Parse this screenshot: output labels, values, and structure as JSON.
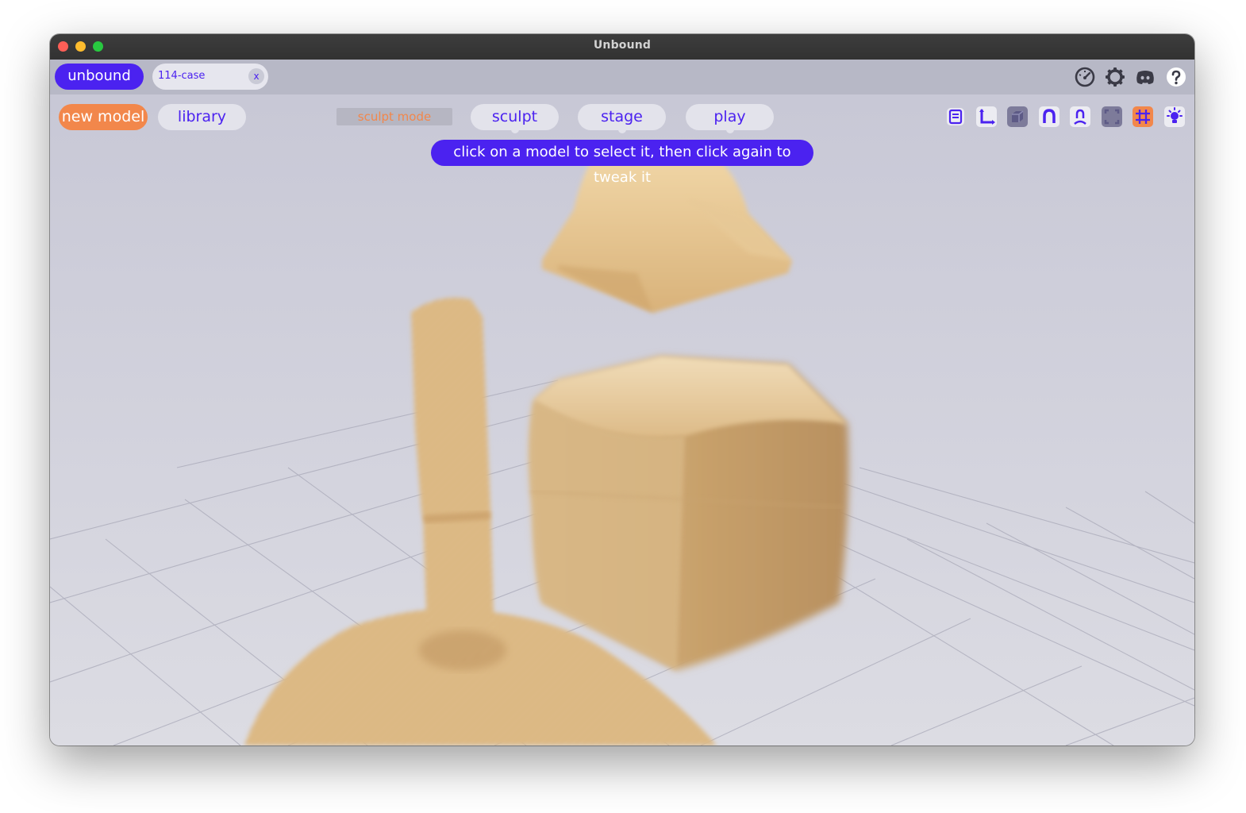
{
  "window": {
    "title": "Unbound"
  },
  "tabbar": {
    "app_label": "unbound",
    "document_tab": {
      "label": "114-case",
      "close_label": "x"
    },
    "system_icons": [
      "performance-gauge-icon",
      "settings-gear-icon",
      "discord-icon",
      "help-icon"
    ]
  },
  "toolbar": {
    "new_model_label": "new model",
    "library_label": "library",
    "mode_label": "sculpt mode",
    "mode_tabs": [
      {
        "label": "sculpt"
      },
      {
        "label": "stage"
      },
      {
        "label": "play"
      }
    ],
    "hint": "click on a model to select it, then click again to tweak it",
    "view_tools": [
      "outline-panel-icon",
      "axis-transform-icon",
      "solid-shading-icon",
      "magnet-snap-icon",
      "pose-person-icon",
      "frame-focus-icon",
      "grid-icon",
      "lighting-icon"
    ]
  },
  "colors": {
    "accent": "#4b22f0",
    "highlight_orange": "#f2874b",
    "model_tan": "#d8b47e"
  }
}
